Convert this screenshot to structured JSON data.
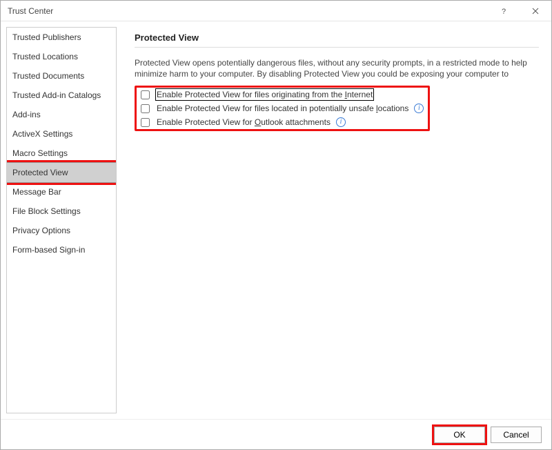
{
  "window": {
    "title": "Trust Center"
  },
  "sidebar": {
    "items": [
      {
        "label": "Trusted Publishers",
        "selected": false
      },
      {
        "label": "Trusted Locations",
        "selected": false
      },
      {
        "label": "Trusted Documents",
        "selected": false
      },
      {
        "label": "Trusted Add-in Catalogs",
        "selected": false
      },
      {
        "label": "Add-ins",
        "selected": false
      },
      {
        "label": "ActiveX Settings",
        "selected": false
      },
      {
        "label": "Macro Settings",
        "selected": false
      },
      {
        "label": "Protected View",
        "selected": true
      },
      {
        "label": "Message Bar",
        "selected": false
      },
      {
        "label": "File Block Settings",
        "selected": false
      },
      {
        "label": "Privacy Options",
        "selected": false
      },
      {
        "label": "Form-based Sign-in",
        "selected": false
      }
    ]
  },
  "main": {
    "heading": "Protected View",
    "description": "Protected View opens potentially dangerous files, without any security prompts, in a restricted mode to help minimize harm to your computer. By disabling Protected View you could be exposing your computer to possible security threats",
    "options": [
      {
        "pre": "Enable Protected View for files originating from the ",
        "mnemonic": "I",
        "post": "nternet",
        "checked": false,
        "hasInfo": false,
        "focused": true
      },
      {
        "pre": "Enable Protected View for files located in potentially unsafe ",
        "mnemonic": "l",
        "post": "ocations",
        "checked": false,
        "hasInfo": true,
        "focused": false
      },
      {
        "pre": "Enable Protected View for ",
        "mnemonic": "O",
        "post": "utlook attachments",
        "checked": false,
        "hasInfo": true,
        "focused": false
      }
    ]
  },
  "footer": {
    "ok": "OK",
    "cancel": "Cancel"
  },
  "icons": {
    "info_glyph": "i"
  }
}
